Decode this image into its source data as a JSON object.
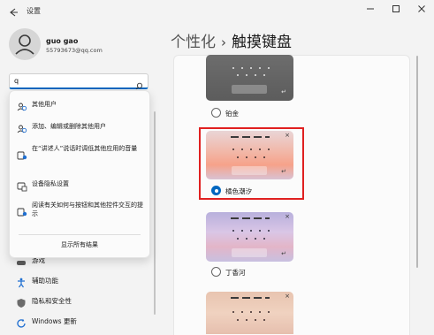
{
  "window": {
    "title": "设置"
  },
  "user": {
    "name": "guo gao",
    "email": "55793673@qq.com"
  },
  "search": {
    "value": "q"
  },
  "search_results": [
    {
      "label": "其他用户",
      "icon": "users-icon"
    },
    {
      "label": "添加、编辑或删除其他用户",
      "icon": "users-icon"
    },
    {
      "label": "在“讲述人”说话时调低其他应用的音量",
      "icon": "narrator-icon"
    },
    {
      "label": "设备隐私设置",
      "icon": "privacy-icon"
    },
    {
      "label": "阅读有关如何与按钮和其他控件交互的提示",
      "icon": "narrator-icon"
    }
  ],
  "show_all_label": "显示所有结果",
  "nav": [
    {
      "label": "游戏",
      "icon": "game-icon"
    },
    {
      "label": "辅助功能",
      "icon": "accessibility-icon"
    },
    {
      "label": "隐私和安全性",
      "icon": "shield-icon"
    },
    {
      "label": "Windows 更新",
      "icon": "update-icon"
    }
  ],
  "page": {
    "breadcrumb_parent": "个性化",
    "separator": "›",
    "title": "触摸键盘"
  },
  "themes": [
    {
      "name": "铂金",
      "selected": false
    },
    {
      "name": "橘色潮汐",
      "selected": true
    },
    {
      "name": "丁香河",
      "selected": false
    }
  ],
  "colors": {
    "accent": "#0067c0",
    "highlight": "#e02020"
  }
}
